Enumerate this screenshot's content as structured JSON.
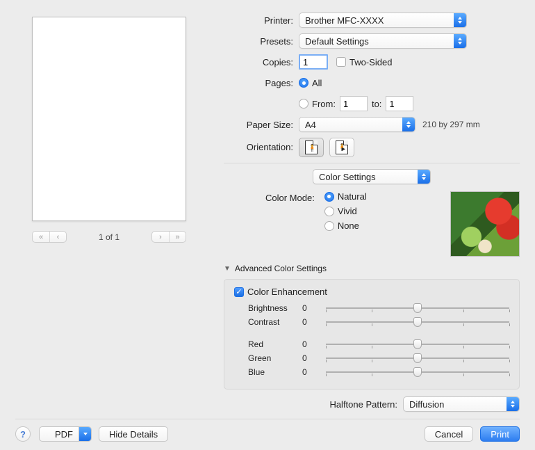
{
  "printer": {
    "label": "Printer:",
    "value": "Brother MFC-XXXX"
  },
  "presets": {
    "label": "Presets:",
    "value": "Default Settings"
  },
  "copies": {
    "label": "Copies:",
    "value": "1",
    "two_sided_label": "Two-Sided",
    "two_sided_checked": false
  },
  "pages": {
    "label": "Pages:",
    "all_label": "All",
    "all_selected": true,
    "from_label": "From:",
    "from_value": "1",
    "to_label": "to:",
    "to_value": "1"
  },
  "paper_size": {
    "label": "Paper Size:",
    "value": "A4",
    "dimensions": "210 by 297 mm"
  },
  "orientation": {
    "label": "Orientation:"
  },
  "section": {
    "value": "Color Settings"
  },
  "color_mode": {
    "label": "Color Mode:",
    "options": {
      "natural": "Natural",
      "vivid": "Vivid",
      "none": "None"
    },
    "selected": "natural"
  },
  "advanced_header": "Advanced Color Settings",
  "color_enhancement": {
    "label": "Color Enhancement",
    "checked": true
  },
  "sliders": {
    "brightness": {
      "label": "Brightness",
      "value": "0"
    },
    "contrast": {
      "label": "Contrast",
      "value": "0"
    },
    "red": {
      "label": "Red",
      "value": "0"
    },
    "green": {
      "label": "Green",
      "value": "0"
    },
    "blue": {
      "label": "Blue",
      "value": "0"
    }
  },
  "halftone": {
    "label": "Halftone Pattern:",
    "value": "Diffusion"
  },
  "pager": {
    "text": "1 of 1"
  },
  "footer": {
    "help": "?",
    "pdf": "PDF",
    "hide_details": "Hide Details",
    "cancel": "Cancel",
    "print": "Print"
  }
}
